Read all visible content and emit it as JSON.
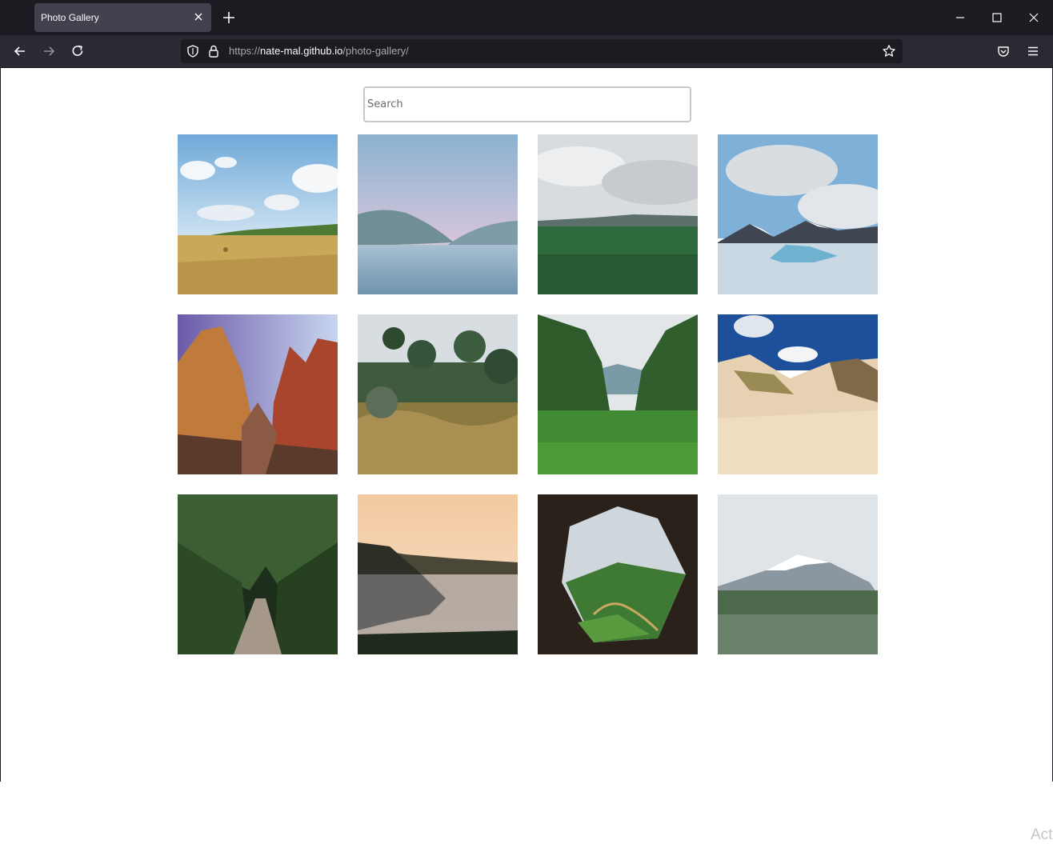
{
  "browser": {
    "tab_title": "Photo Gallery",
    "url_scheme": "https://",
    "url_host": "nate-mal.github.io",
    "url_path": "/photo-gallery/"
  },
  "search": {
    "placeholder": "Search",
    "value": ""
  },
  "photos": [
    {
      "subject": "hay field under blue sky"
    },
    {
      "subject": "lake with mountains at dusk"
    },
    {
      "subject": "green meadow with cloudy sky"
    },
    {
      "subject": "glacier lagoon with icebergs"
    },
    {
      "subject": "red rock canyon"
    },
    {
      "subject": "garden with trees and shrubs"
    },
    {
      "subject": "green valley with trees"
    },
    {
      "subject": "sand dunes with grass"
    },
    {
      "subject": "forest path"
    },
    {
      "subject": "coastal cliffs at sunset"
    },
    {
      "subject": "view from cave onto valley"
    },
    {
      "subject": "snowy mountain over meadow"
    }
  ],
  "watermark": "Act"
}
